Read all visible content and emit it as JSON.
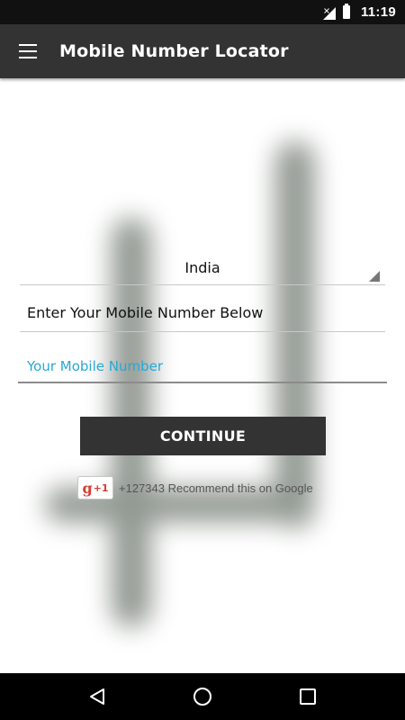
{
  "status_bar": {
    "time": "11:19",
    "icons": [
      "signal-off-icon",
      "battery-icon"
    ]
  },
  "app_bar": {
    "title": "Mobile Number Locator",
    "menu_icon": "hamburger-menu-icon"
  },
  "form": {
    "country_selected": "India",
    "prompt": "Enter Your Mobile Number Below",
    "phone_placeholder": "Your Mobile Number",
    "phone_value": "",
    "continue_label": "CONTINUE"
  },
  "gplus": {
    "icon_text": "g",
    "icon_plus": "+1",
    "recommend_text": "+127343 Recommend this on Google"
  },
  "nav_bar": {
    "icons": [
      "back-icon",
      "home-icon",
      "recents-icon"
    ]
  },
  "colors": {
    "app_bar": "#333333",
    "status_bar": "#111111",
    "accent": "#27a8d6",
    "button": "#333333",
    "gplus_red": "#d73d32"
  }
}
